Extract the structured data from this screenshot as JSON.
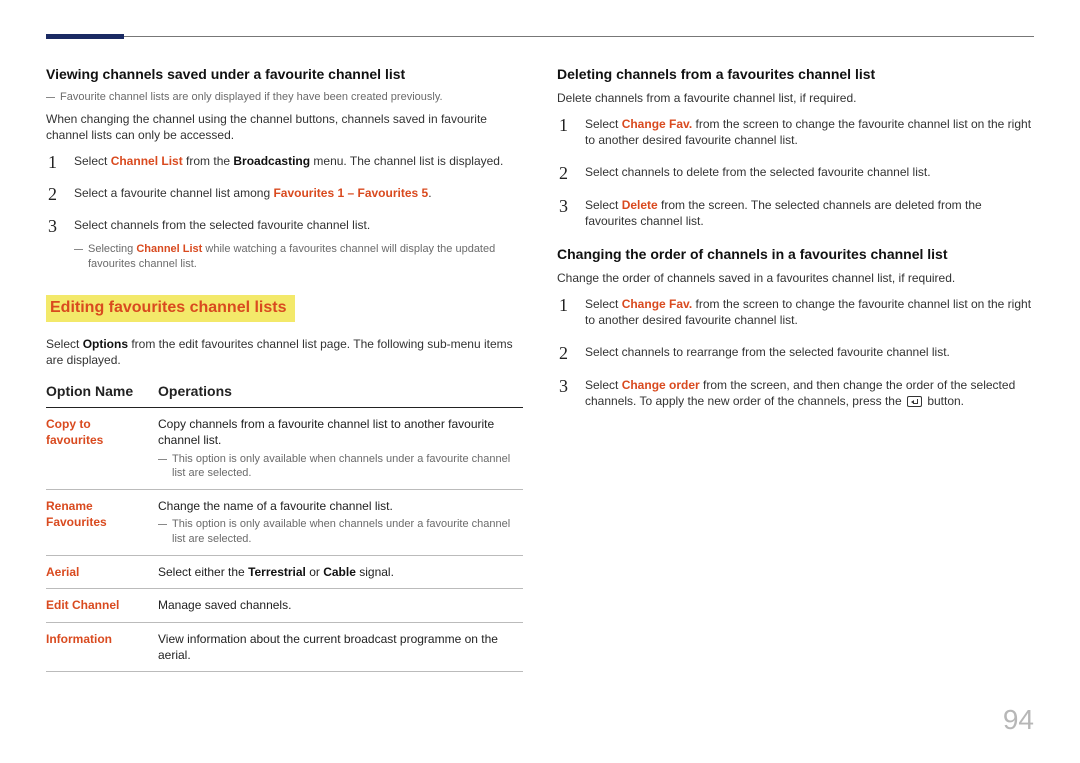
{
  "page_number": "94",
  "left": {
    "viewing": {
      "heading": "Viewing channels saved under a favourite channel list",
      "note": "Favourite channel lists are only displayed if they have been created previously.",
      "para": "When changing the channel using the channel buttons, channels saved in favourite channel lists can only be accessed.",
      "steps": {
        "s1": {
          "a": "Select ",
          "b": "Channel List",
          "c": " from the ",
          "d": "Broadcasting",
          "e": " menu. The channel list is displayed."
        },
        "s2": {
          "a": "Select a favourite channel list among ",
          "b": "Favourites 1",
          "dash": " – ",
          "c": "Favourites 5",
          "d": "."
        },
        "s3": {
          "a": "Select channels from the selected favourite channel list."
        }
      },
      "indent_note": {
        "a": "Selecting ",
        "b": "Channel List",
        "c": " while watching a favourites channel will display the updated favourites channel list."
      }
    },
    "editing": {
      "title": "Editing favourites channel lists",
      "intro": {
        "a": "Select ",
        "b": "Options",
        "c": " from the edit favourites channel list page. The following sub-menu items are displayed."
      },
      "table": {
        "head1": "Option Name",
        "head2": "Operations",
        "r1": {
          "name": "Copy to favourites",
          "desc": "Copy channels from a favourite channel list to another favourite channel list.",
          "note": "This option is only available when channels under a favourite channel list are selected."
        },
        "r2": {
          "name": "Rename Favourites",
          "desc": "Change the name of a favourite channel list.",
          "note": "This option is only available when channels under a favourite channel list are selected."
        },
        "r3": {
          "name": "Aerial",
          "desc_a": "Select either the ",
          "desc_b": "Terrestrial",
          "desc_mid": " or ",
          "desc_c": "Cable",
          "desc_d": " signal."
        },
        "r4": {
          "name": "Edit Channel",
          "desc": "Manage saved channels."
        },
        "r5": {
          "name": "Information",
          "desc": "View information about the current broadcast programme on the aerial."
        }
      }
    }
  },
  "right": {
    "deleting": {
      "heading": "Deleting channels from a favourites channel list",
      "para": "Delete channels from a favourite channel list, if required.",
      "s1": {
        "a": "Select ",
        "b": "Change Fav.",
        "c": " from the screen to change the favourite channel list on the right to another desired favourite channel list."
      },
      "s2": {
        "a": "Select channels to delete from the selected favourite channel list."
      },
      "s3": {
        "a": "Select ",
        "b": "Delete",
        "c": " from the screen. The selected channels are deleted from the favourites channel list."
      }
    },
    "ordering": {
      "heading": "Changing the order of channels in a favourites channel list",
      "para": "Change the order of channels saved in a favourites channel list, if required.",
      "s1": {
        "a": "Select ",
        "b": "Change Fav.",
        "c": " from the screen to change the favourite channel list on the right to another desired favourite channel list."
      },
      "s2": {
        "a": "Select channels to rearrange from the selected favourite channel list."
      },
      "s3": {
        "a": "Select ",
        "b": "Change order",
        "c": " from the screen, and then change the order of the selected channels. To apply the new order of the channels, press the ",
        "d": " button."
      }
    }
  }
}
